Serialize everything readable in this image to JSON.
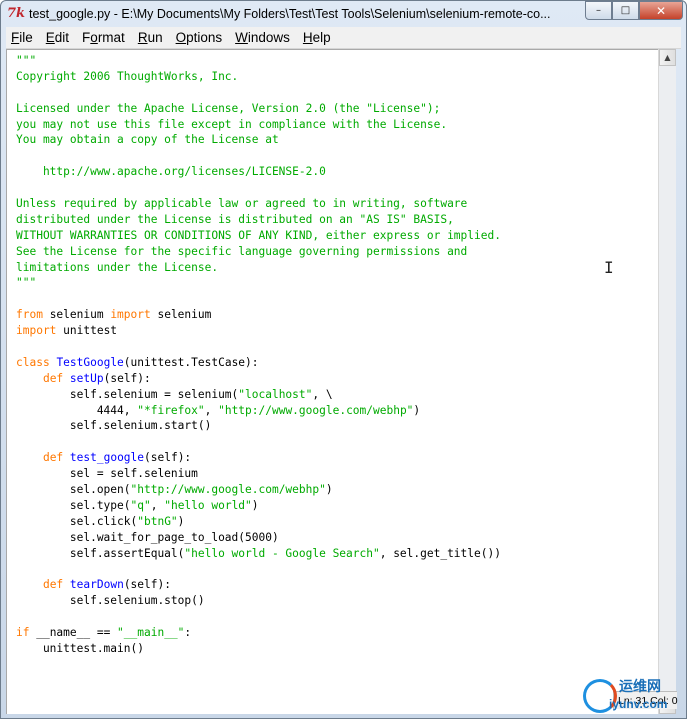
{
  "window": {
    "title": "test_google.py - E:\\My Documents\\My Folders\\Test\\Test Tools\\Selenium\\selenium-remote-co...",
    "app_icon_text": "7k",
    "controls": {
      "minimize": "–",
      "maximize": "□",
      "close": "✕"
    }
  },
  "menubar": {
    "items": [
      {
        "label": "File",
        "key": "F",
        "rest": "ile"
      },
      {
        "label": "Edit",
        "key": "E",
        "rest": "dit"
      },
      {
        "label": "Format",
        "key": "",
        "pre": "F",
        "keychar": "o",
        "post": "rmat"
      },
      {
        "label": "Run",
        "key": "R",
        "rest": "un"
      },
      {
        "label": "Options",
        "key": "O",
        "rest": "ptions"
      },
      {
        "label": "Windows",
        "key": "W",
        "rest": "indows"
      },
      {
        "label": "Help",
        "key": "H",
        "rest": "elp"
      }
    ]
  },
  "editor": {
    "lines": [
      [
        [
          "s",
          "\"\"\""
        ]
      ],
      [
        [
          "s",
          "Copyright 2006 ThoughtWorks, Inc."
        ]
      ],
      [
        [
          "",
          ""
        ]
      ],
      [
        [
          "s",
          "Licensed under the Apache License, Version 2.0 (the \"License\");"
        ]
      ],
      [
        [
          "s",
          "you may not use this file except in compliance with the License."
        ]
      ],
      [
        [
          "s",
          "You may obtain a copy of the License at"
        ]
      ],
      [
        [
          "",
          ""
        ]
      ],
      [
        [
          "s",
          "    http://www.apache.org/licenses/LICENSE-2.0"
        ]
      ],
      [
        [
          "",
          ""
        ]
      ],
      [
        [
          "s",
          "Unless required by applicable law or agreed to in writing, software"
        ]
      ],
      [
        [
          "s",
          "distributed under the License is distributed on an \"AS IS\" BASIS,"
        ]
      ],
      [
        [
          "s",
          "WITHOUT WARRANTIES OR CONDITIONS OF ANY KIND, either express or implied."
        ]
      ],
      [
        [
          "s",
          "See the License for the specific language governing permissions and"
        ]
      ],
      [
        [
          "s",
          "limitations under the License."
        ]
      ],
      [
        [
          "s",
          "\"\"\""
        ]
      ],
      [
        [
          "",
          ""
        ]
      ],
      [
        [
          "k",
          "from"
        ],
        [
          "",
          " selenium "
        ],
        [
          "k",
          "import"
        ],
        [
          "",
          " selenium"
        ]
      ],
      [
        [
          "k",
          "import"
        ],
        [
          "",
          " unittest"
        ]
      ],
      [
        [
          "",
          ""
        ]
      ],
      [
        [
          "k",
          "class"
        ],
        [
          "",
          " "
        ],
        [
          "f",
          "TestGoogle"
        ],
        [
          "",
          "(unittest.TestCase):"
        ]
      ],
      [
        [
          "",
          "    "
        ],
        [
          "k",
          "def"
        ],
        [
          "",
          " "
        ],
        [
          "f",
          "setUp"
        ],
        [
          "",
          "(self):"
        ]
      ],
      [
        [
          "",
          "        self.selenium = selenium("
        ],
        [
          "s",
          "\"localhost\""
        ],
        [
          "",
          ", \\"
        ]
      ],
      [
        [
          "",
          "            4444, "
        ],
        [
          "s",
          "\"*firefox\""
        ],
        [
          "",
          ", "
        ],
        [
          "s",
          "\"http://www.google.com/webhp\""
        ],
        [
          "",
          ")"
        ]
      ],
      [
        [
          "",
          "        self.selenium.start()"
        ]
      ],
      [
        [
          "",
          ""
        ]
      ],
      [
        [
          "",
          "    "
        ],
        [
          "k",
          "def"
        ],
        [
          "",
          " "
        ],
        [
          "f",
          "test_google"
        ],
        [
          "",
          "(self):"
        ]
      ],
      [
        [
          "",
          "        sel = self.selenium"
        ]
      ],
      [
        [
          "",
          "        sel.open("
        ],
        [
          "s",
          "\"http://www.google.com/webhp\""
        ],
        [
          "",
          ")"
        ]
      ],
      [
        [
          "",
          "        sel.type("
        ],
        [
          "s",
          "\"q\""
        ],
        [
          "",
          ", "
        ],
        [
          "s",
          "\"hello world\""
        ],
        [
          "",
          ")"
        ]
      ],
      [
        [
          "",
          "        sel.click("
        ],
        [
          "s",
          "\"btnG\""
        ],
        [
          "",
          ")"
        ]
      ],
      [
        [
          "",
          "        sel.wait_for_page_to_load(5000)"
        ]
      ],
      [
        [
          "",
          "        self.assertEqual("
        ],
        [
          "s",
          "\"hello world - Google Search\""
        ],
        [
          "",
          ", sel.get_title())"
        ]
      ],
      [
        [
          "",
          ""
        ]
      ],
      [
        [
          "",
          "    "
        ],
        [
          "k",
          "def"
        ],
        [
          "",
          " "
        ],
        [
          "f",
          "tearDown"
        ],
        [
          "",
          "(self):"
        ]
      ],
      [
        [
          "",
          "        self.selenium.stop()"
        ]
      ],
      [
        [
          "",
          ""
        ]
      ],
      [
        [
          "k",
          "if"
        ],
        [
          "",
          " __name__ == "
        ],
        [
          "s",
          "\"__main__\""
        ],
        [
          "",
          ":"
        ]
      ],
      [
        [
          "",
          "    unittest.main()"
        ]
      ]
    ]
  },
  "scrollbar": {
    "up_icon": "▲",
    "down_icon": "▼"
  },
  "statusbar": {
    "position": "Ln: 31 Col: 0"
  },
  "watermark": {
    "brand_cn": "运维网",
    "url": "iyunv.com"
  },
  "colors": {
    "string": "#00aa00",
    "keyword": "#ff7700",
    "definition": "#0000ff",
    "text": "#000000"
  }
}
